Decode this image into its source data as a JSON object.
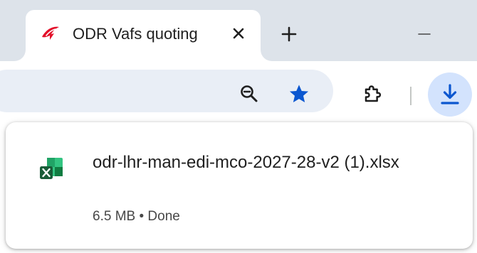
{
  "tab": {
    "title": "ODR Vafs quoting",
    "favicon": "airline-logo-icon"
  },
  "tabstrip": {
    "new_tab_icon": "plus-icon",
    "close_icon": "close-icon",
    "minimize_icon": "minimize-icon"
  },
  "toolbar": {
    "zoom_icon": "zoom-out-icon",
    "bookmark_icon": "star-icon",
    "extensions_icon": "puzzle-icon",
    "download_icon": "download-icon"
  },
  "download": {
    "file_name": "odr-lhr-man-edi-mco-2027-28-v2 (1).xlsx",
    "status": "6.5 MB • Done",
    "file_icon": "excel-file-icon"
  },
  "colors": {
    "tabstrip_bg": "#dde3ea",
    "omnibox_bg": "#e9eef6",
    "star": "#0b57d0",
    "download_btn_bg": "#d3e3fd",
    "download_icon": "#0b57d0",
    "favicon_red": "#e3102a",
    "excel_green": "#1f9d55"
  }
}
